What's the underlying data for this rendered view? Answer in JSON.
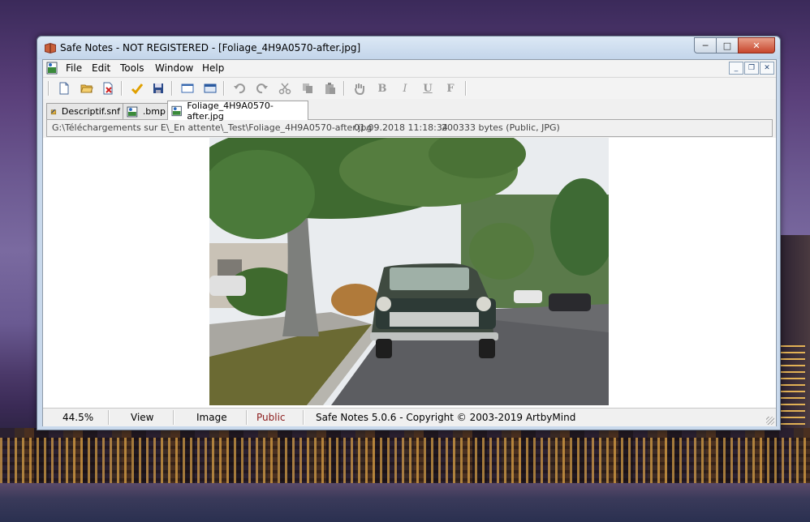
{
  "window": {
    "title": "Safe Notes - NOT REGISTERED - [Foliage_4H9A0570-after.jpg]",
    "controls": {
      "minimize": "─",
      "maximize": "□",
      "close": "✕"
    }
  },
  "menu": {
    "items": [
      "File",
      "Edit",
      "Tools",
      "Window",
      "Help"
    ],
    "mdi_controls": {
      "minimize": "_",
      "restore": "❐",
      "close": "✕"
    }
  },
  "toolbar": {
    "buttons": [
      {
        "name": "new-note-button",
        "icon": "new-document-icon"
      },
      {
        "name": "open-button",
        "icon": "open-folder-icon"
      },
      {
        "name": "delete-button",
        "icon": "delete-document-icon"
      },
      {
        "name": "check-button",
        "icon": "checkmark-icon"
      },
      {
        "name": "save-button",
        "icon": "floppy-disk-icon"
      },
      {
        "name": "window-button",
        "icon": "window-icon"
      },
      {
        "name": "window-alt-button",
        "icon": "window-blue-icon"
      },
      {
        "name": "undo-button",
        "icon": "undo-icon"
      },
      {
        "name": "redo-button",
        "icon": "redo-icon"
      },
      {
        "name": "cut-button",
        "icon": "scissors-icon"
      },
      {
        "name": "copy-button",
        "icon": "copy-icon"
      },
      {
        "name": "paste-button",
        "icon": "paste-icon"
      },
      {
        "name": "hand-button",
        "icon": "hand-icon"
      },
      {
        "name": "bold-button",
        "icon": "bold-icon",
        "label": "B"
      },
      {
        "name": "italic-button",
        "icon": "italic-icon",
        "label": "I"
      },
      {
        "name": "underline-button",
        "icon": "underline-icon",
        "label": "U"
      },
      {
        "name": "font-button",
        "icon": "font-icon",
        "label": "F"
      }
    ]
  },
  "tabs": [
    {
      "label": "Descriptif.snf",
      "icon": "notebook-icon",
      "active": false
    },
    {
      "label": ".bmp",
      "icon": "image-icon",
      "active": false
    },
    {
      "label": "Foliage_4H9A0570-after.jpg",
      "icon": "image-icon",
      "active": true
    }
  ],
  "pathbar": {
    "path": "G:\\Téléchargements sur E\\_En attente\\_Test\\Foliage_4H9A0570-after.jpg",
    "date": "01.09.2018 11:18:34",
    "size": "200333 bytes (Public, JPG)"
  },
  "status": {
    "zoom": "44.5%",
    "view": "View",
    "image": "Image",
    "visibility": "Public",
    "copyright": "Safe Notes 5.0.6   -  Copyright © 2003-2019 ArtbyMind"
  },
  "colors": {
    "public_text": "#8b1a1a",
    "titlebar": "#c3d5ea",
    "close_button": "#c7462c"
  }
}
